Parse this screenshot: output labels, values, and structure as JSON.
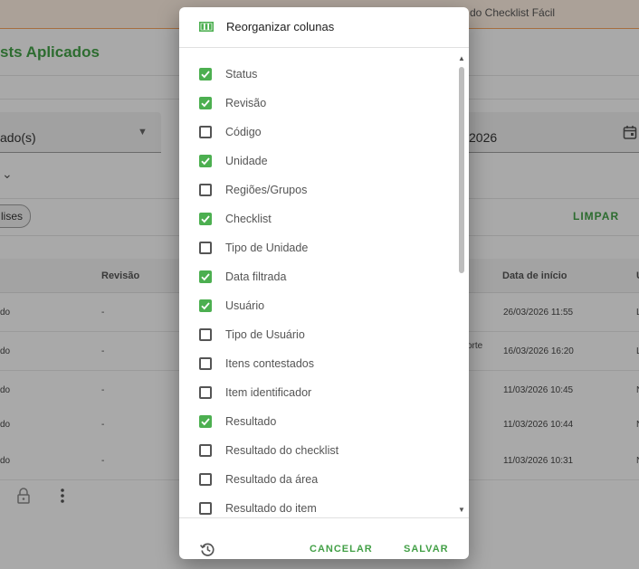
{
  "background": {
    "banner_text": "do Checklist Fácil",
    "page_title": "sts Aplicados",
    "status_select_value": "ado(s)",
    "date_value": "2026",
    "chip_label": "lises",
    "clear_label": "LIMPAR",
    "columns": [
      "Revisão",
      "Data de início",
      "U"
    ],
    "rows": [
      {
        "status": "do",
        "revision": "-",
        "extra": "",
        "start": "26/03/2026 11:55",
        "user": "L"
      },
      {
        "status": "do",
        "revision": "-",
        "extra": "orte",
        "start": "16/03/2026 16:20",
        "user": "L"
      },
      {
        "status": "do",
        "revision": "-",
        "extra": "",
        "start": "11/03/2026 10:45",
        "user": "N"
      },
      {
        "status": "do",
        "revision": "-",
        "extra": "",
        "start": "11/03/2026 10:44",
        "user": "N"
      },
      {
        "status": "do",
        "revision": "-",
        "extra": "",
        "start": "11/03/2026 10:31",
        "user": "N"
      }
    ]
  },
  "dialog": {
    "title": "Reorganizar colunas",
    "items": [
      {
        "label": "Status",
        "checked": true
      },
      {
        "label": "Revisão",
        "checked": true
      },
      {
        "label": "Código",
        "checked": false
      },
      {
        "label": "Unidade",
        "checked": true
      },
      {
        "label": "Regiões/Grupos",
        "checked": false
      },
      {
        "label": "Checklist",
        "checked": true
      },
      {
        "label": "Tipo de Unidade",
        "checked": false
      },
      {
        "label": "Data filtrada",
        "checked": true
      },
      {
        "label": "Usuário",
        "checked": true
      },
      {
        "label": "Tipo de Usuário",
        "checked": false
      },
      {
        "label": "Itens contestados",
        "checked": false
      },
      {
        "label": "Item identificador",
        "checked": false
      },
      {
        "label": "Resultado",
        "checked": true
      },
      {
        "label": "Resultado do checklist",
        "checked": false
      },
      {
        "label": "Resultado da área",
        "checked": false
      },
      {
        "label": "Resultado do item",
        "checked": false
      }
    ],
    "cancel_label": "CANCELAR",
    "save_label": "SALVAR"
  },
  "colors": {
    "accent": "#4caf50",
    "accent_text": "#43a047",
    "banner_bg": "#fdeee1"
  },
  "icons": {
    "header": "view-column-icon",
    "footer": "history-icon",
    "date": "calendar-icon",
    "row_actions": [
      "lock-icon",
      "more-vert-icon"
    ]
  }
}
